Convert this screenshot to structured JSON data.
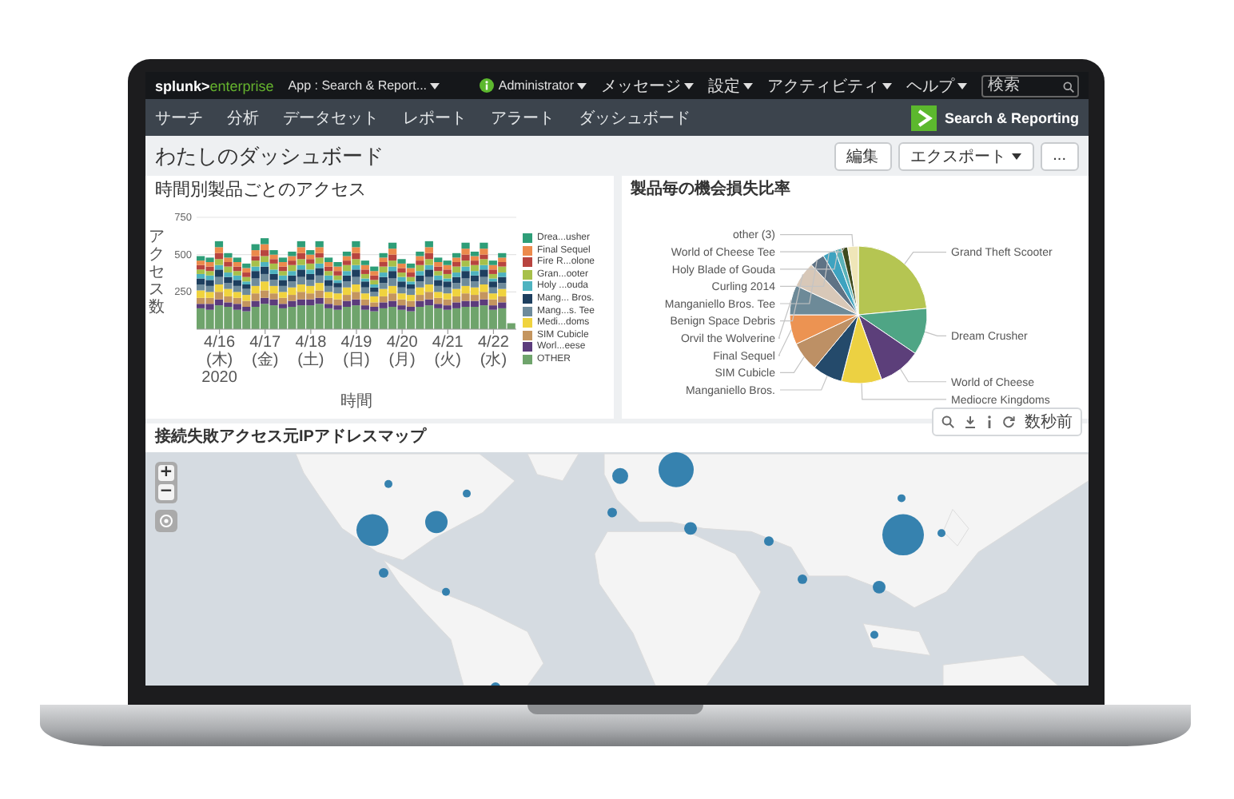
{
  "top_bar": {
    "logo_prefix": "splunk>",
    "logo_suffix": "enterprise",
    "app_menu": "App : Search & Report...",
    "user_menu": "Administrator",
    "menus": [
      "メッセージ",
      "設定",
      "アクティビティ",
      "ヘルプ"
    ],
    "search": {
      "placeholder": "検索"
    }
  },
  "app_bar": {
    "nav": [
      "サーチ",
      "分析",
      "データセット",
      "レポート",
      "アラート",
      "ダッシュボード"
    ],
    "app_name": "Search & Reporting"
  },
  "dashboard": {
    "title": "わたしのダッシュボード",
    "buttons": [
      {
        "label": "編集",
        "dropdown": false
      },
      {
        "label": "エクスポート",
        "dropdown": true
      },
      {
        "label": "...",
        "dropdown": false
      }
    ]
  },
  "panels": [
    {
      "title": "時間別製品ごとのアクセス",
      "chart_data": {
        "type": "bar",
        "stacked": true,
        "legend": "right",
        "orientation": "vertical",
        "xlabel": "時間",
        "ylabel": "アクセス数",
        "ylim": [
          0,
          750
        ],
        "yticks": [
          250,
          500,
          750
        ],
        "categories": [
          null,
          null,
          "4/16 (木) 2020",
          null,
          null,
          null,
          null,
          "4/17 (金)",
          null,
          null,
          null,
          null,
          "4/18 (土)",
          null,
          null,
          null,
          null,
          "4/19 (日)",
          null,
          null,
          null,
          null,
          "4/20 (月)",
          null,
          null,
          null,
          null,
          "4/21 (火)",
          null,
          null,
          null,
          null,
          "4/22 (水)",
          null,
          null
        ],
        "series": [
          {
            "name": "Drea...usher",
            "color": "#2e9e78",
            "values": [
              30,
              30,
              40,
              30,
              30,
              30,
              40,
              40,
              30,
              30,
              30,
              40,
              30,
              40,
              30,
              30,
              30,
              40,
              30,
              30,
              30,
              40,
              30,
              30,
              30,
              40,
              30,
              30,
              30,
              40,
              30,
              40,
              30,
              30,
              null
            ]
          },
          {
            "name": "Final Sequel",
            "color": "#ec8a4c",
            "values": [
              30,
              30,
              40,
              30,
              30,
              30,
              40,
              40,
              30,
              30,
              30,
              40,
              30,
              40,
              30,
              30,
              30,
              40,
              30,
              30,
              30,
              40,
              30,
              30,
              30,
              40,
              30,
              30,
              30,
              40,
              30,
              40,
              30,
              30,
              null
            ]
          },
          {
            "name": "Fire R...olone",
            "color": "#b8443f",
            "values": [
              30,
              30,
              40,
              30,
              30,
              30,
              30,
              40,
              30,
              30,
              30,
              40,
              30,
              30,
              30,
              30,
              30,
              40,
              30,
              30,
              30,
              40,
              30,
              30,
              30,
              40,
              30,
              30,
              30,
              40,
              30,
              30,
              30,
              30,
              null
            ]
          },
          {
            "name": "Gran...ooter",
            "color": "#a7c04a",
            "values": [
              30,
              30,
              40,
              40,
              30,
              30,
              40,
              40,
              40,
              30,
              40,
              40,
              40,
              40,
              30,
              30,
              40,
              40,
              30,
              30,
              40,
              40,
              30,
              30,
              40,
              40,
              30,
              30,
              40,
              40,
              40,
              40,
              30,
              40,
              null
            ]
          },
          {
            "name": "Holy ...ouda",
            "color": "#4eb3c0",
            "values": [
              30,
              30,
              30,
              30,
              30,
              20,
              30,
              30,
              30,
              30,
              30,
              30,
              30,
              30,
              30,
              20,
              30,
              30,
              20,
              20,
              30,
              30,
              30,
              20,
              30,
              30,
              30,
              20,
              30,
              30,
              30,
              30,
              20,
              30,
              null
            ]
          },
          {
            "name": "Mang... Bros.",
            "color": "#1e3f5f",
            "values": [
              40,
              40,
              50,
              40,
              40,
              30,
              50,
              50,
              40,
              40,
              40,
              50,
              40,
              50,
              40,
              30,
              40,
              50,
              40,
              30,
              40,
              50,
              40,
              30,
              40,
              50,
              40,
              40,
              40,
              50,
              40,
              50,
              40,
              40,
              null
            ]
          },
          {
            "name": "Mang...s. Tee",
            "color": "#6e8b9b",
            "values": [
              40,
              40,
              50,
              40,
              40,
              40,
              50,
              50,
              40,
              40,
              40,
              50,
              40,
              50,
              40,
              40,
              40,
              50,
              40,
              30,
              40,
              50,
              40,
              40,
              40,
              50,
              40,
              40,
              40,
              50,
              40,
              50,
              40,
              40,
              null
            ]
          },
          {
            "name": "Medi...doms",
            "color": "#f0d33e",
            "values": [
              50,
              40,
              50,
              50,
              40,
              40,
              50,
              60,
              50,
              40,
              50,
              50,
              50,
              50,
              40,
              40,
              50,
              50,
              40,
              40,
              50,
              50,
              40,
              40,
              50,
              50,
              40,
              40,
              50,
              50,
              50,
              50,
              40,
              50,
              null
            ]
          },
          {
            "name": "SIM Cubicle",
            "color": "#c4955f",
            "values": [
              40,
              40,
              50,
              40,
              40,
              40,
              50,
              50,
              40,
              40,
              40,
              50,
              40,
              50,
              40,
              40,
              40,
              50,
              40,
              30,
              40,
              50,
              40,
              40,
              40,
              50,
              40,
              40,
              40,
              50,
              40,
              50,
              40,
              40,
              null
            ]
          },
          {
            "name": "Worl...eese",
            "color": "#5c3c7c",
            "values": [
              30,
              40,
              40,
              30,
              40,
              30,
              40,
              40,
              40,
              30,
              40,
              40,
              40,
              40,
              30,
              30,
              40,
              40,
              30,
              30,
              40,
              40,
              30,
              30,
              40,
              40,
              30,
              30,
              40,
              40,
              40,
              40,
              30,
              40,
              null
            ]
          },
          {
            "name": "OTHER",
            "color": "#6fa46c",
            "values": [
              140,
              130,
              160,
              150,
              130,
              120,
              150,
              170,
              160,
              140,
              150,
              160,
              160,
              170,
              140,
              130,
              150,
              160,
              130,
              120,
              140,
              150,
              130,
              120,
              150,
              160,
              140,
              130,
              140,
              150,
              150,
              160,
              130,
              140,
              40
            ]
          }
        ]
      }
    },
    {
      "title": "製品毎の機会損失比率",
      "chart_data": {
        "type": "pie",
        "categories": [
          "Grand Theft Scooter",
          "Dream Crusher",
          "World of Cheese",
          "Mediocre Kingdoms",
          "Manganiello Bros.",
          "SIM Cubicle",
          "Final Sequel",
          "Orvil the Wolverine",
          "Benign Space Debris",
          "Manganiello Bros. Tee",
          "Curling 2014",
          "Holy Blade of Gouda",
          "World of Cheese Tee",
          "other (3)"
        ],
        "values": [
          23.5,
          11,
          10,
          9.5,
          7,
          7,
          7,
          7,
          6,
          3.5,
          3,
          1.5,
          1.5,
          2.5
        ],
        "colors": [
          "#b5c552",
          "#4fa585",
          "#5c3f7a",
          "#ecd142",
          "#244a6b",
          "#bd9065",
          "#ec9352",
          "#6d8a98",
          "#d8c8b8",
          "#5f7385",
          "#3ea3c0",
          "#5bb3b9",
          "#3e4a1e",
          "#efe6b8"
        ]
      },
      "toolbar": {
        "timestamp": "数秒前"
      }
    }
  ],
  "map_panel": {
    "title": "接続失敗アクセス元IPアドレスマップ",
    "zoom_in": "+",
    "zoom_out": "−"
  }
}
